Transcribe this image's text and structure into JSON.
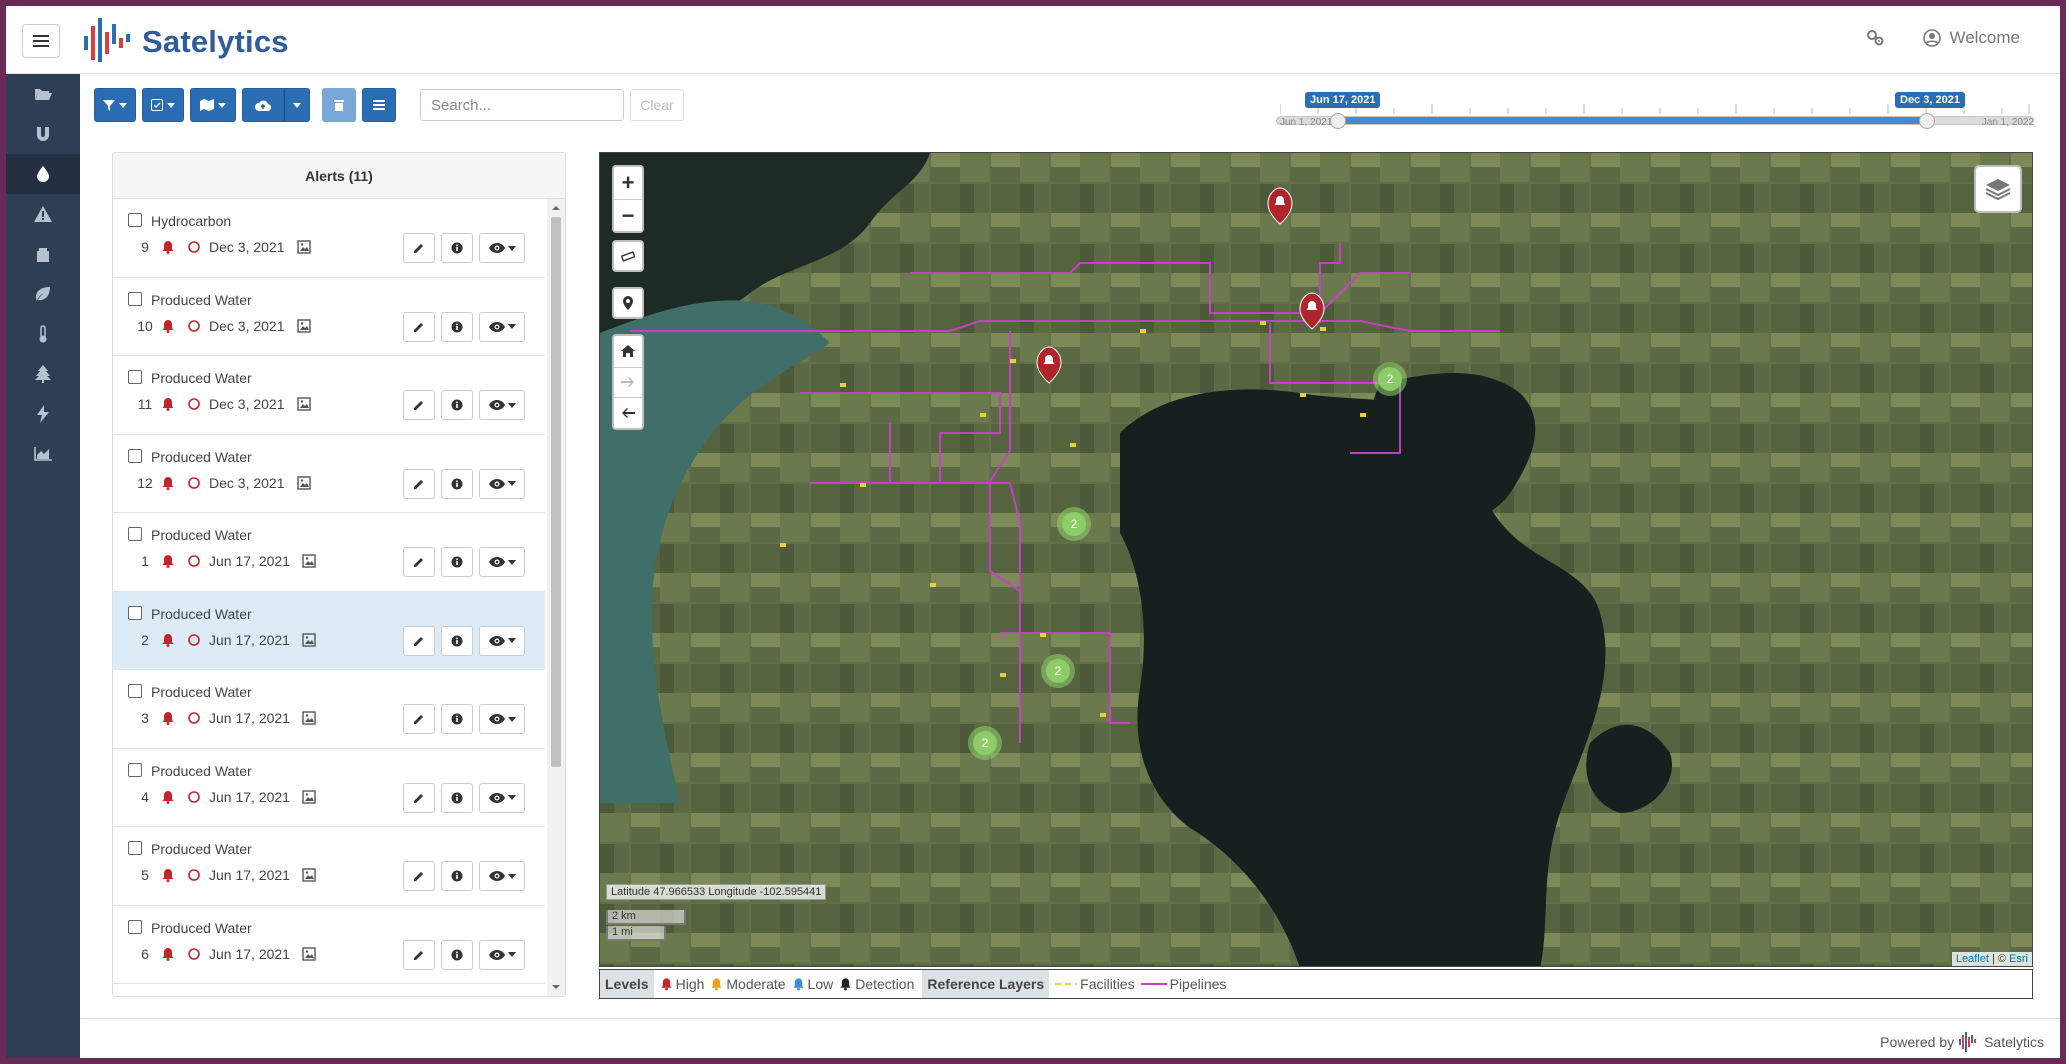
{
  "app": {
    "name": "Satelytics",
    "welcome": "Welcome"
  },
  "toolbar": {
    "search_placeholder": "Search...",
    "clear_label": "Clear",
    "buttons": [
      "filter",
      "check-square",
      "map",
      "cloud-upload",
      "trash",
      "list"
    ]
  },
  "timeline": {
    "start_label": "Jun 17, 2021",
    "end_label": "Dec 3, 2021",
    "min_label": "Jun 1, 2021",
    "max_label": "Jan 1, 2022"
  },
  "alerts": {
    "title": "Alerts (11)",
    "items": [
      {
        "type": "Hydrocarbon",
        "id": "9",
        "date": "Dec 3, 2021",
        "selected": false
      },
      {
        "type": "Produced Water",
        "id": "10",
        "date": "Dec 3, 2021",
        "selected": false
      },
      {
        "type": "Produced Water",
        "id": "11",
        "date": "Dec 3, 2021",
        "selected": false
      },
      {
        "type": "Produced Water",
        "id": "12",
        "date": "Dec 3, 2021",
        "selected": false
      },
      {
        "type": "Produced Water",
        "id": "1",
        "date": "Jun 17, 2021",
        "selected": false
      },
      {
        "type": "Produced Water",
        "id": "2",
        "date": "Jun 17, 2021",
        "selected": true
      },
      {
        "type": "Produced Water",
        "id": "3",
        "date": "Jun 17, 2021",
        "selected": false
      },
      {
        "type": "Produced Water",
        "id": "4",
        "date": "Jun 17, 2021",
        "selected": false
      },
      {
        "type": "Produced Water",
        "id": "5",
        "date": "Jun 17, 2021",
        "selected": false
      },
      {
        "type": "Produced Water",
        "id": "6",
        "date": "Jun 17, 2021",
        "selected": false
      }
    ]
  },
  "map": {
    "coords": "Latitude 47.966533 Longitude -102.595441",
    "scale_km": "2 km",
    "scale_mi": "1 mi",
    "attribution_leaflet": "Leaflet",
    "attribution_sep": " | © ",
    "attribution_esri": "Esri",
    "clusters": [
      "2",
      "2",
      "2",
      "2"
    ]
  },
  "legend": {
    "levels_title": "Levels",
    "high": "High",
    "moderate": "Moderate",
    "low": "Low",
    "detection": "Detection",
    "ref_title": "Reference Layers",
    "facilities": "Facilities",
    "pipelines": "Pipelines"
  },
  "footer": {
    "powered_by": "Powered by",
    "brand": "Satelytics"
  },
  "colors": {
    "primary": "#2a6db2",
    "sidebar": "#2e3f55",
    "alert_red": "#c0272d",
    "moderate": "#f0a020",
    "low": "#3a8dd6",
    "pipeline": "#cc3fcc",
    "facility": "#e8d03a",
    "cluster": "#8fd16a"
  }
}
